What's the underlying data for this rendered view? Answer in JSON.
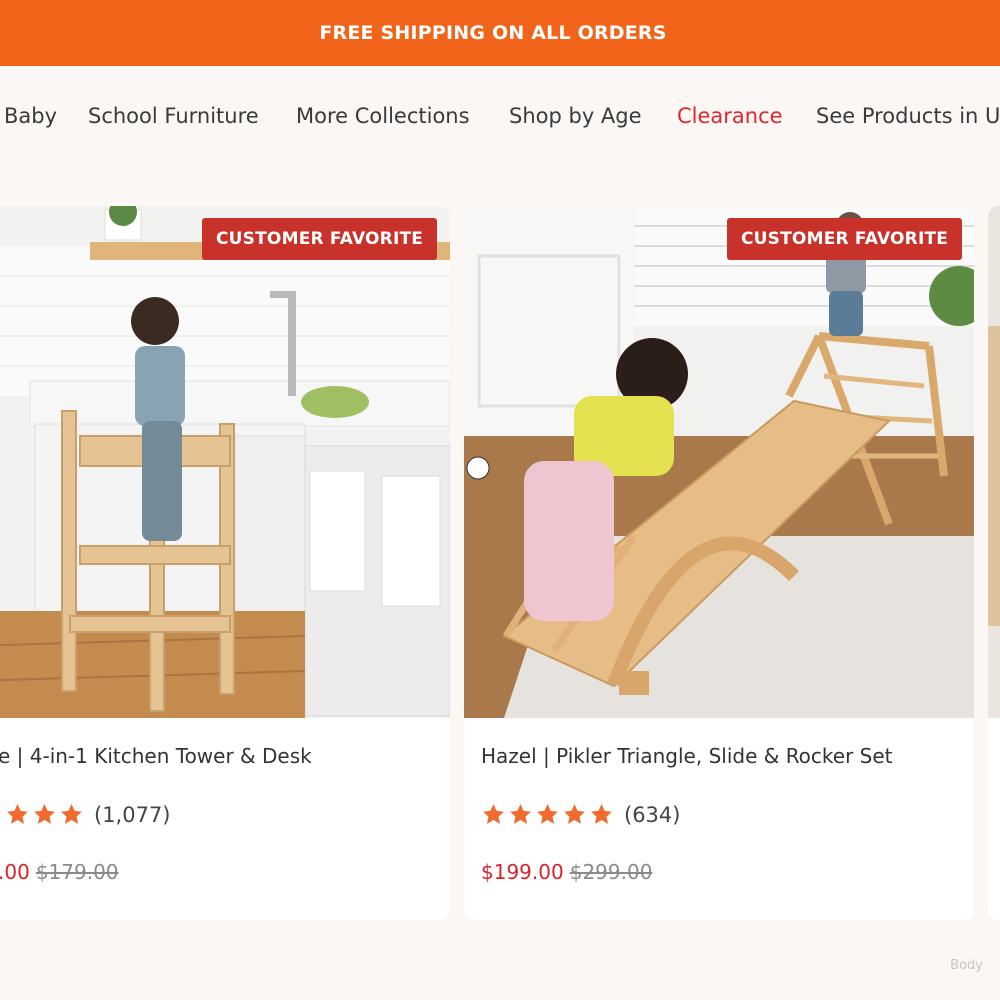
{
  "announcement": "FREE SHIPPING ON ALL ORDERS",
  "nav": {
    "items": [
      {
        "label": "Baby"
      },
      {
        "label": "School Furniture"
      },
      {
        "label": "More Collections"
      },
      {
        "label": "Shop by Age"
      },
      {
        "label": "Clearance",
        "highlight": "#e0262e"
      },
      {
        "label": "See Products in U"
      }
    ]
  },
  "products": [
    {
      "badge": "CUSTOMER FAVORITE",
      "title": "e | 4-in-1 Kitchen Tower & Desk",
      "rating_stars": 5,
      "review_count": "(1,077)",
      "price": ".00",
      "compare_price": "$179.00"
    },
    {
      "badge": "CUSTOMER FAVORITE",
      "title": "Hazel | Pikler Triangle, Slide & Rocker Set",
      "rating_stars": 5,
      "review_count": "(634)",
      "price": "$199.00",
      "compare_price": "$299.00"
    }
  ],
  "watermark": "Body",
  "colors": {
    "accent": "#f26419",
    "badge": "#c8322b",
    "sale_price": "#d8232a",
    "star": "#f26b2d",
    "background": "#fbf7f4"
  }
}
